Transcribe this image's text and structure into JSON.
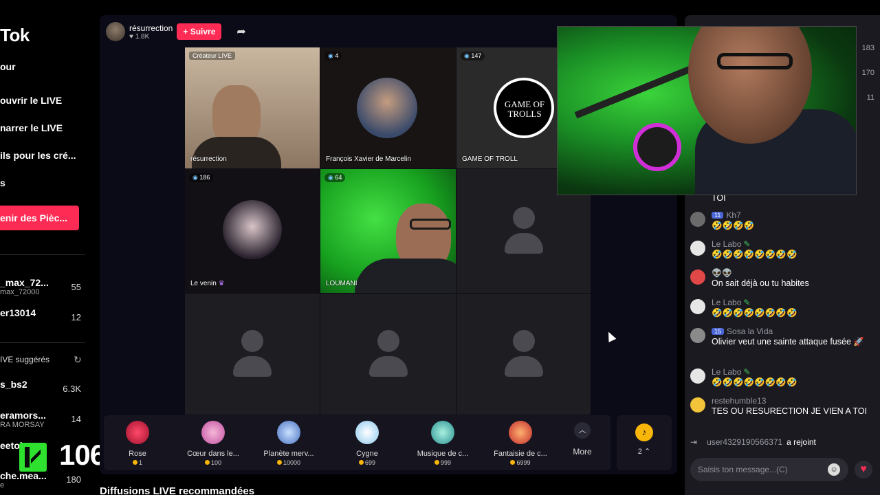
{
  "sidebar": {
    "brand": "Tok",
    "nav": [
      "our",
      "ouvrir le LIVE",
      "narrer le LIVE",
      "ils pour les cré...",
      "s"
    ],
    "coins_button": "enir des Pièc...",
    "following": [
      {
        "name": "_max_72...",
        "sub": "max_72000",
        "count": "55"
      },
      {
        "name": "er13014",
        "sub": "",
        "count": "12"
      }
    ],
    "suggested_header": "IVE suggérés",
    "suggested": [
      {
        "name": "s_bs2",
        "sub": "",
        "count": "6.3K"
      },
      {
        "name": "eramors...",
        "sub": "RA MORSAY",
        "count": "14"
      },
      {
        "name": "eetob...",
        "sub": "",
        "count": ""
      },
      {
        "name": "che.mea...",
        "sub": "e",
        "count": "180"
      }
    ]
  },
  "overlay": {
    "count": "1066"
  },
  "host": {
    "name": "résurrection",
    "likes": "1.8K",
    "follow_label": "+ Suivre"
  },
  "tiles": [
    {
      "badge": "Créateur LIVE",
      "name": "résurrection"
    },
    {
      "badge": "4",
      "name": "François Xavier de Marcelin"
    },
    {
      "badge": "147",
      "name": "GAME OF TROLL",
      "logo": "GAME OF TROLLS"
    },
    {
      "badge": "186",
      "name": "Le venin"
    },
    {
      "badge": "64",
      "name": "LOUMANI"
    },
    {
      "badge": "",
      "name": ""
    },
    {
      "badge": "",
      "name": ""
    },
    {
      "badge": "",
      "name": ""
    },
    {
      "badge": "",
      "name": ""
    }
  ],
  "gifts": [
    {
      "name": "Rose",
      "price": "1",
      "icon": "rose-icon",
      "color": "#e0204a"
    },
    {
      "name": "Cœur dans le...",
      "price": "100",
      "icon": "heart-hands-icon",
      "color": "#e6a0c8"
    },
    {
      "name": "Planète merv...",
      "price": "10000",
      "icon": "planet-icon",
      "color": "#7aa8e8"
    },
    {
      "name": "Cygne",
      "price": "699",
      "icon": "swan-icon",
      "color": "#b8dff8"
    },
    {
      "name": "Musique de c...",
      "price": "999",
      "icon": "drum-icon",
      "color": "#6cc0c8"
    },
    {
      "name": "Fantaisie de c...",
      "price": "6999",
      "icon": "carousel-icon",
      "color": "#e0603a"
    }
  ],
  "more_label": "More",
  "coin_count": "2",
  "recommended_title": "Diffusions LIVE recommandées",
  "chat": {
    "ranks": [
      "183",
      "170",
      "11"
    ],
    "partial_text": "TOI",
    "messages": [
      {
        "user": "Kh7",
        "level": "11",
        "text": "🤣🤣🤣🤣",
        "avatar_color": "#6b6b6b"
      },
      {
        "user": "Le Labo",
        "level": "",
        "text": "🤣🤣🤣🤣🤣🤣🤣🤣",
        "avatar_color": "#e6e6e6"
      },
      {
        "user": "👽👽",
        "level": "",
        "text": "On sait déjà ou tu habites",
        "avatar_color": "#e04848"
      },
      {
        "user": "Le Labo",
        "level": "",
        "text": "🤣🤣🤣🤣🤣🤣🤣🤣",
        "avatar_color": "#e6e6e6"
      },
      {
        "user": "Sosa la Vida",
        "level": "15",
        "text": "Olivier veut une sainte attaque fusée 🚀",
        "avatar_color": "#8a8a8a"
      },
      {
        "user": "Le Labo",
        "level": "",
        "text": "🤣🤣🤣🤣🤣🤣🤣🤣",
        "avatar_color": "#e6e6e6"
      },
      {
        "user": "restehumble13",
        "level": "",
        "text": "TES OU RESURECTION JE VIEN A TOI",
        "avatar_color": "#f3c43a"
      }
    ],
    "join": {
      "user": "user4329190566371",
      "text": "a rejoint"
    },
    "input_placeholder": "Saisis ton message...(C)"
  }
}
